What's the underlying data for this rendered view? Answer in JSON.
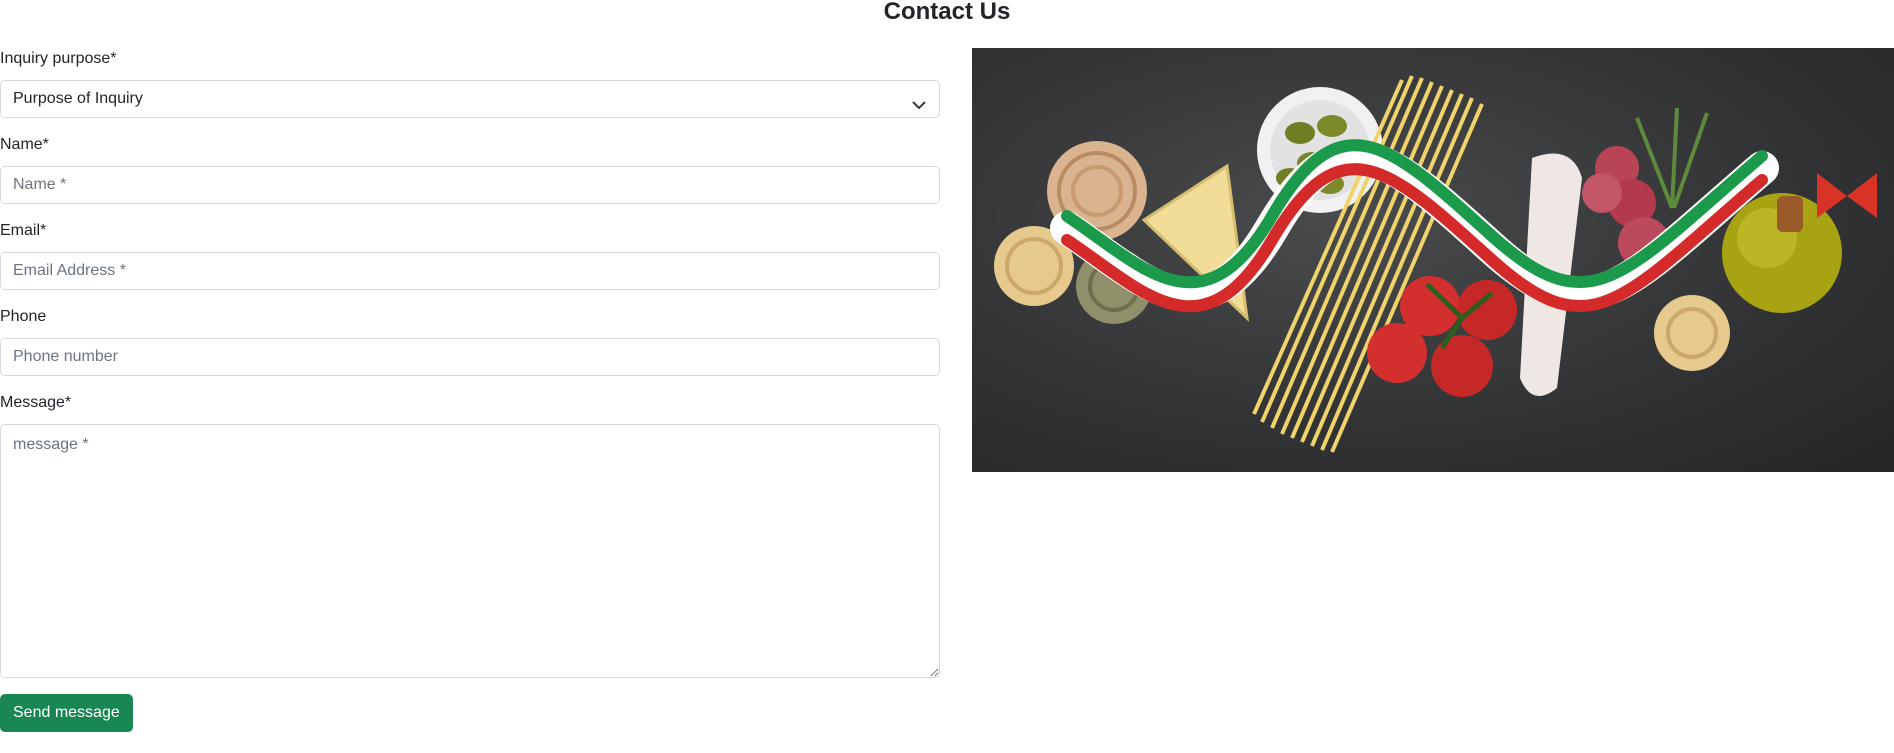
{
  "page": {
    "title": "Contact Us"
  },
  "form": {
    "inquiry": {
      "label": "Inquiry purpose*",
      "selected": "Purpose of Inquiry"
    },
    "name": {
      "label": "Name*",
      "placeholder": "Name *"
    },
    "email": {
      "label": "Email*",
      "placeholder": "Email Address *"
    },
    "phone": {
      "label": "Phone",
      "placeholder": "Phone number"
    },
    "message": {
      "label": "Message*",
      "placeholder": "message *"
    },
    "submit_label": "Send message"
  },
  "hero_image": {
    "subject": "italian-food-ingredients-photo"
  },
  "colors": {
    "accent": "#198754",
    "text": "#212529",
    "placeholder": "#6c757d",
    "border": "#d6dadf"
  }
}
